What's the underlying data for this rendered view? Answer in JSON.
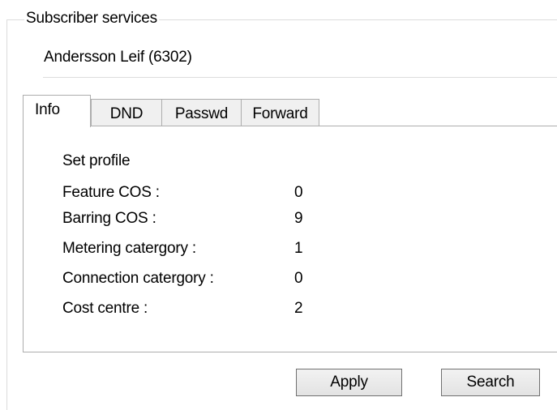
{
  "group": {
    "title": "Subscriber services"
  },
  "subscriber": {
    "name": "Andersson Leif (6302)"
  },
  "tabs": [
    {
      "label": "Info",
      "active": true
    },
    {
      "label": "DND",
      "active": false
    },
    {
      "label": "Passwd",
      "active": false
    },
    {
      "label": "Forward",
      "active": false
    }
  ],
  "info": {
    "heading": "Set profile",
    "rows": [
      {
        "label": "Feature COS :",
        "value": "0"
      },
      {
        "label": "Barring COS :",
        "value": "9"
      },
      {
        "label": "Metering catergory :",
        "value": "1"
      },
      {
        "label": "Connection catergory :",
        "value": "0"
      },
      {
        "label": "Cost centre :",
        "value": "2"
      }
    ]
  },
  "buttons": {
    "apply_label": "Apply",
    "search_label": "Search"
  }
}
